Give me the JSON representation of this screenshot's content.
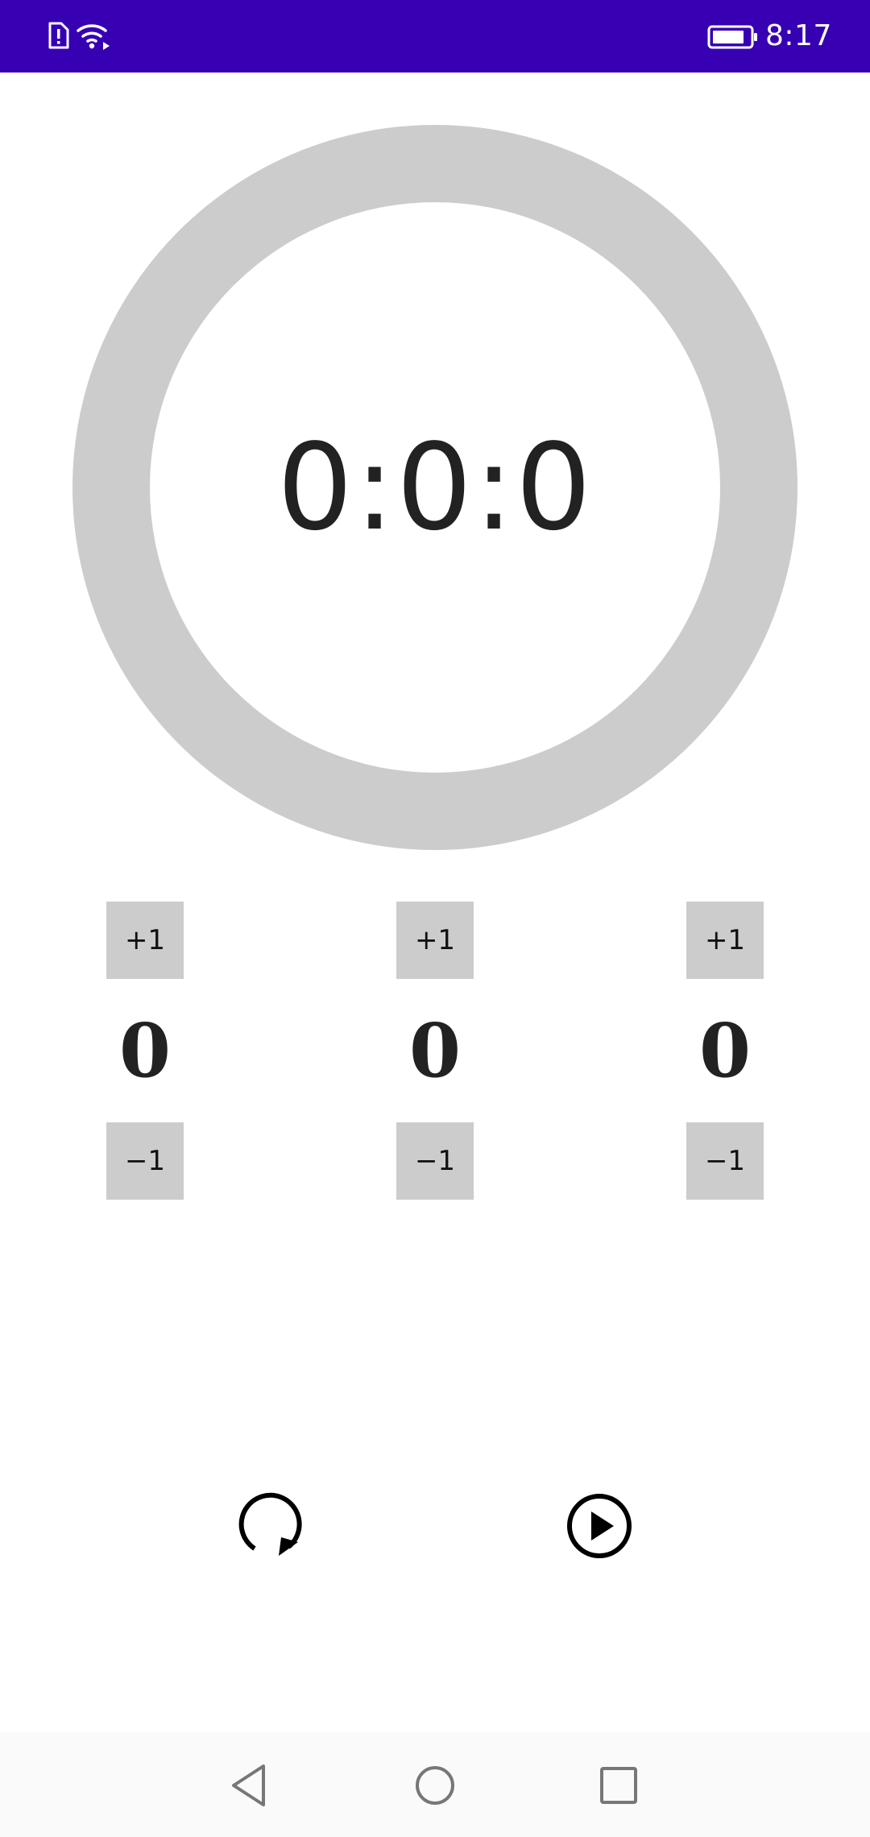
{
  "status_bar": {
    "time": "8:17",
    "icons": [
      "sim-alert-icon",
      "wifi-icon",
      "battery-icon"
    ],
    "background_color": "#3700b3"
  },
  "timer": {
    "display": "0:0:0",
    "ring_color": "#cccccc"
  },
  "counters": [
    {
      "increment_label": "+1",
      "value": "0",
      "decrement_label": "−1"
    },
    {
      "increment_label": "+1",
      "value": "0",
      "decrement_label": "−1"
    },
    {
      "increment_label": "+1",
      "value": "0",
      "decrement_label": "−1"
    }
  ],
  "controls": {
    "reset_icon": "reset-icon",
    "play_icon": "play-icon"
  },
  "nav_bar": {
    "icons": [
      "back-icon",
      "home-icon",
      "recents-icon"
    ]
  }
}
